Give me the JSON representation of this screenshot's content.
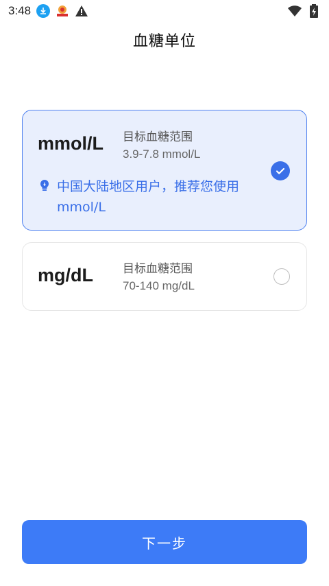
{
  "status_bar": {
    "time": "3:48",
    "icons": [
      "download-icon",
      "app-notification-icon",
      "warning-icon",
      "wifi-icon",
      "battery-charging-icon"
    ]
  },
  "page": {
    "title": "血糖单位"
  },
  "options": [
    {
      "unit": "mmol/L",
      "range_label": "目标血糖范围",
      "range_value": "3.9-7.8 mmol/L",
      "tip": "中国大陆地区用户，推荐您使用mmol/L",
      "selected": true
    },
    {
      "unit": "mg/dL",
      "range_label": "目标血糖范围",
      "range_value": "70-140 mg/dL",
      "selected": false
    }
  ],
  "footer": {
    "next_label": "下一步"
  },
  "colors": {
    "accent": "#3d7bf7",
    "selected_bg": "#e9effd",
    "tip_text": "#3a6fe8"
  }
}
